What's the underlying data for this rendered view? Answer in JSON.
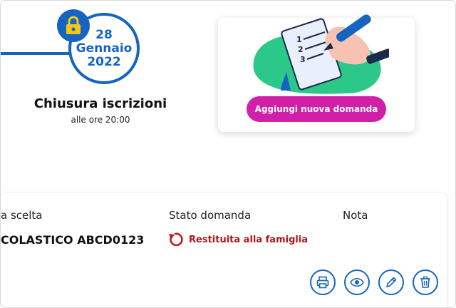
{
  "deadline": {
    "day": "28",
    "month": "Gennaio",
    "year": "2022",
    "title": "Chiusura iscrizioni",
    "time": "alle ore 20:00",
    "icon": "lock-icon"
  },
  "new_application": {
    "button_label": "Aggiungi nuova domanda",
    "illustration_list_numbers": [
      "1",
      "2",
      "3"
    ]
  },
  "application_table": {
    "headers": {
      "choice": "a scelta",
      "status": "Stato domanda",
      "note": "Nota"
    },
    "row": {
      "school": "COLASTICO ABCD0123",
      "status_label": "Restituita alla famiglia",
      "status_icon": "undo-arrow-icon",
      "note": ""
    },
    "actions": [
      "print-icon",
      "eye-icon",
      "pencil-icon",
      "trash-icon"
    ]
  },
  "colors": {
    "primary": "#1565c0",
    "accent": "#d21fa8",
    "status_returned": "#b01818"
  }
}
